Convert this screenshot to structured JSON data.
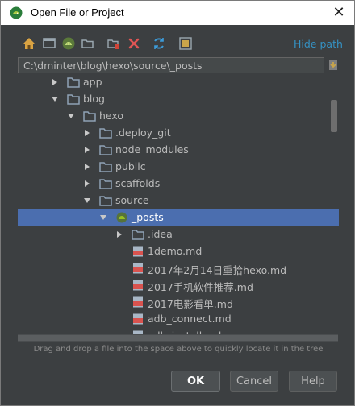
{
  "window": {
    "title": "Open File or Project",
    "close_glyph": "✕"
  },
  "toolbar": {
    "icons": [
      "home-icon",
      "desktop-icon",
      "android-project-icon",
      "new-folder-icon",
      "delete-marker-icon",
      "delete-icon",
      "refresh-icon",
      "show-hidden-icon"
    ],
    "hide_path_label": "Hide path"
  },
  "path": {
    "value": "C:\\dminter\\blog\\hexo\\source\\_posts",
    "history_icon": "history-icon"
  },
  "tree": {
    "items": [
      {
        "label": "app",
        "depth": 0,
        "type": "folder",
        "expand": "collapsed"
      },
      {
        "label": "blog",
        "depth": 0,
        "type": "folder",
        "expand": "expanded"
      },
      {
        "label": "hexo",
        "depth": 1,
        "type": "folder",
        "expand": "expanded"
      },
      {
        "label": ".deploy_git",
        "depth": 2,
        "type": "folder",
        "expand": "collapsed"
      },
      {
        "label": "node_modules",
        "depth": 2,
        "type": "folder",
        "expand": "collapsed"
      },
      {
        "label": "public",
        "depth": 2,
        "type": "folder",
        "expand": "collapsed"
      },
      {
        "label": "scaffolds",
        "depth": 2,
        "type": "folder",
        "expand": "collapsed"
      },
      {
        "label": "source",
        "depth": 2,
        "type": "folder",
        "expand": "expanded"
      },
      {
        "label": "_posts",
        "depth": 3,
        "type": "android",
        "expand": "expanded",
        "selected": true
      },
      {
        "label": ".idea",
        "depth": 4,
        "type": "folder",
        "expand": "collapsed"
      },
      {
        "label": "1demo.md",
        "depth": 4,
        "type": "md",
        "expand": "none"
      },
      {
        "label": "2017年2月14日重拾hexo.md",
        "depth": 4,
        "type": "md",
        "expand": "none"
      },
      {
        "label": "2017手机软件推荐.md",
        "depth": 4,
        "type": "md",
        "expand": "none"
      },
      {
        "label": "2017电影看单.md",
        "depth": 4,
        "type": "md",
        "expand": "none"
      },
      {
        "label": "adb_connect.md",
        "depth": 4,
        "type": "md",
        "expand": "none"
      },
      {
        "label": "adb_install.md",
        "depth": 4,
        "type": "md",
        "expand": "none"
      }
    ]
  },
  "hint": "Drag and drop a file into the space above to quickly locate it in the tree",
  "buttons": {
    "ok": "OK",
    "cancel": "Cancel",
    "help": "Help"
  },
  "colors": {
    "background": "#3c3f41",
    "selection": "#4b6eaf",
    "link": "#3592c4",
    "folder": "#8fa2b6",
    "android": "#97c024"
  }
}
